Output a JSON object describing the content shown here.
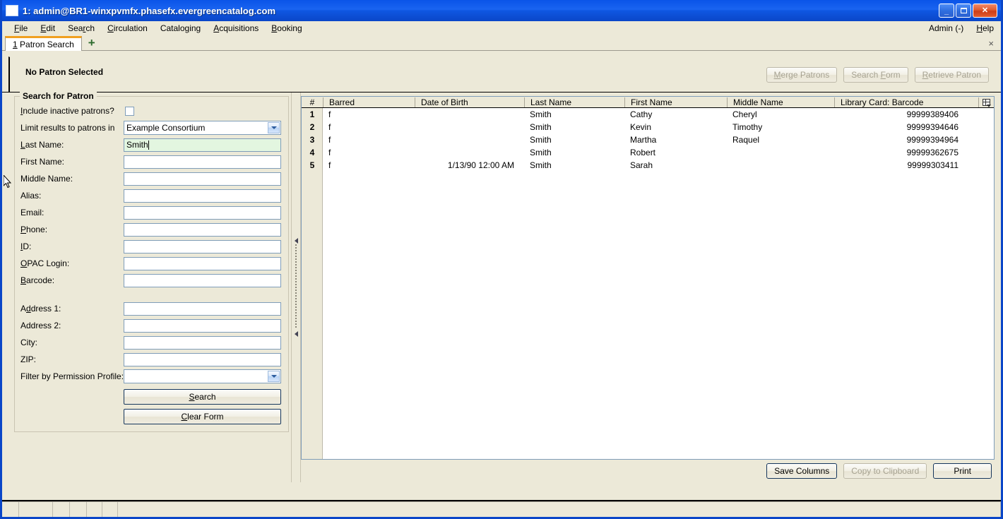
{
  "window": {
    "title": "1: admin@BR1-winxpvmfx.phasefx.evergreencatalog.com",
    "minimize_label": "_",
    "maximize_label": "",
    "close_label": "✕"
  },
  "menubar": {
    "items": [
      {
        "label": "File",
        "accel": "F"
      },
      {
        "label": "Edit",
        "accel": "E"
      },
      {
        "label": "Search",
        "accel": "r"
      },
      {
        "label": "Circulation",
        "accel": "C"
      },
      {
        "label": "Cataloging",
        "accel": "g"
      },
      {
        "label": "Acquisitions",
        "accel": "A"
      },
      {
        "label": "Booking",
        "accel": "B"
      }
    ],
    "admin_label": "Admin (-)",
    "help_label": "Help"
  },
  "tabstrip": {
    "tab_label": "1 Patron Search",
    "new_tab_label": "+",
    "close_label": "×"
  },
  "patron_bar": {
    "status_label": "No Patron Selected",
    "merge_patrons_label": "Merge Patrons",
    "search_form_label": "Search Form",
    "retrieve_patron_label": "Retrieve Patron"
  },
  "search_form": {
    "legend": "Search for Patron",
    "include_inactive_label": "Include inactive patrons?",
    "include_inactive_checked": false,
    "limit_results_label": "Limit results to patrons in",
    "limit_results_value": "Example Consortium",
    "fields": [
      {
        "label": "Last Name:",
        "value": "Smith",
        "focused": true
      },
      {
        "label": "First Name:",
        "value": "",
        "focused": false
      },
      {
        "label": "Middle Name:",
        "value": "",
        "focused": false
      },
      {
        "label": "Alias:",
        "value": "",
        "focused": false
      },
      {
        "label": "Email:",
        "value": "",
        "focused": false
      },
      {
        "label": "Phone:",
        "value": "",
        "focused": false
      },
      {
        "label": "ID:",
        "value": "",
        "focused": false
      },
      {
        "label": "OPAC Login:",
        "value": "",
        "focused": false
      },
      {
        "label": "Barcode:",
        "value": "",
        "focused": false
      }
    ],
    "address_fields": [
      {
        "label": "Address 1:",
        "value": ""
      },
      {
        "label": "Address 2:",
        "value": ""
      },
      {
        "label": "City:",
        "value": ""
      },
      {
        "label": "ZIP:",
        "value": ""
      }
    ],
    "permission_profile_label": "Filter by Permission Profile:",
    "permission_profile_value": "",
    "search_button_label": "Search",
    "clear_form_button_label": "Clear Form"
  },
  "results": {
    "columns": [
      "#",
      "Barred",
      "Date of Birth",
      "Last Name",
      "First Name",
      "Middle Name",
      "Library Card: Barcode"
    ],
    "rows": [
      {
        "num": "1",
        "barred": "f",
        "dob": "",
        "last": "Smith",
        "first": "Cathy",
        "middle": "Cheryl",
        "barcode": "99999389406"
      },
      {
        "num": "2",
        "barred": "f",
        "dob": "",
        "last": "Smith",
        "first": "Kevin",
        "middle": "Timothy",
        "barcode": "99999394646"
      },
      {
        "num": "3",
        "barred": "f",
        "dob": "",
        "last": "Smith",
        "first": "Martha",
        "middle": "Raquel",
        "barcode": "99999394964"
      },
      {
        "num": "4",
        "barred": "f",
        "dob": "",
        "last": "Smith",
        "first": "Robert",
        "middle": "",
        "barcode": "99999362675"
      },
      {
        "num": "5",
        "barred": "f",
        "dob": "1/13/90 12:00 AM",
        "last": "Smith",
        "first": "Sarah",
        "middle": "",
        "barcode": "99999303411"
      }
    ],
    "save_columns_label": "Save Columns",
    "copy_clipboard_label": "Copy to Clipboard",
    "print_label": "Print"
  },
  "colors": {
    "titlebar_blue": "#0a46c8",
    "window_bg": "#ece9d8",
    "focused_input": "#e3f6e0",
    "tab_accent": "#f0a020",
    "input_border": "#7f9db9"
  }
}
